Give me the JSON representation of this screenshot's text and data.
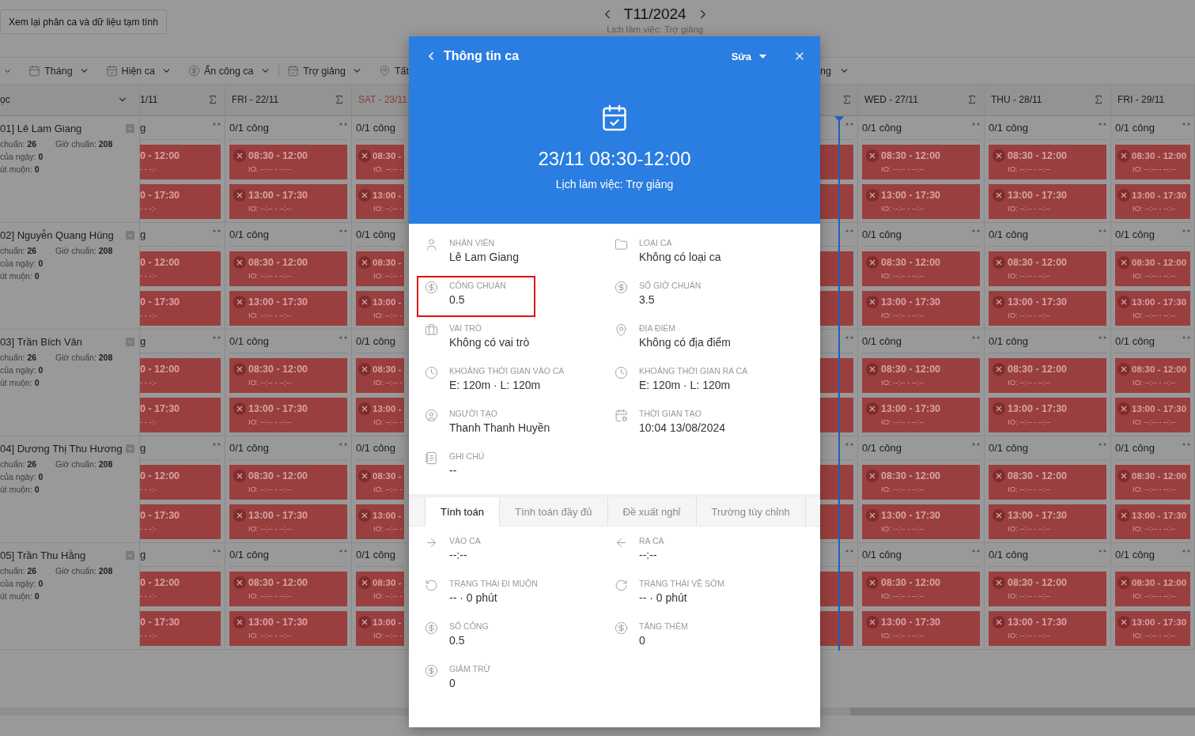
{
  "header": {
    "review_button": "Xem lại phân ca và dữ liệu tạm tính",
    "month": "T11/2024",
    "subtitle": "Lịch làm việc: Trợ giảng"
  },
  "toolbar": {
    "items": [
      {
        "label": "Tháng",
        "divider_before": false
      },
      {
        "label": "Hiện ca",
        "divider_before": false
      },
      {
        "label": "Ẩn công ca",
        "divider_before": false
      },
      {
        "label": "Trợ giảng",
        "divider_before": true
      },
      {
        "label": "Tất",
        "divider_before": false
      }
    ],
    "right_items": [
      {
        "label": "ng"
      }
    ]
  },
  "grid": {
    "employee_header": "ọc",
    "employees": [
      {
        "name": "01] Lê Lam Giang",
        "stats": [
          "chuẩn: **26**",
          "Giờ chuẩn: **208**",
          "của ngày: **0**",
          "út muộn: **0**"
        ]
      },
      {
        "name": "02] Nguyễn Quang Hùng",
        "stats": [
          "chuẩn: **26**",
          "Giờ chuẩn: **208**",
          "của ngày: **0**",
          "út muộn: **0**"
        ]
      },
      {
        "name": "03] Trần Bích Vân",
        "stats": [
          "chuẩn: **26**",
          "Giờ chuẩn: **208**",
          "của ngày: **0**",
          "út muộn: **0**"
        ]
      },
      {
        "name": "04] Dương Thị Thu Hương",
        "stats": [
          "chuẩn: **26**",
          "Giờ chuẩn: **208**",
          "của ngày: **0**",
          "út muộn: **0**"
        ]
      },
      {
        "name": "05] Trần Thu Hằng",
        "stats": [
          "chuẩn: **26**",
          "Giờ chuẩn: **208**",
          "của ngày: **0**",
          "út muộn: **0**"
        ]
      }
    ],
    "left_columns": [
      {
        "kind": "cut_left",
        "header": "1/11",
        "weekend": false,
        "cells": [
          {
            "count": "g",
            "shifts": [
              {
                "cancelled": true,
                "time": "0 - 12:00",
                "io": "- - -:-"
              },
              {
                "cancelled": true,
                "time": "0 - 17:30",
                "io": "- - -:-"
              }
            ]
          },
          {
            "count": "g",
            "shifts": [
              {
                "cancelled": true,
                "time": "0 - 12:00",
                "io": "- - -:-"
              },
              {
                "cancelled": true,
                "time": "0 - 17:30",
                "io": "- - -:-"
              }
            ]
          },
          {
            "count": "g",
            "shifts": [
              {
                "cancelled": true,
                "time": "0 - 12:00",
                "io": "- - -:-"
              },
              {
                "cancelled": true,
                "time": "0 - 17:30",
                "io": "- - -:-"
              }
            ]
          },
          {
            "count": "g",
            "shifts": [
              {
                "cancelled": true,
                "time": "0 - 12:00",
                "io": "- - -:-"
              },
              {
                "cancelled": true,
                "time": "0 - 17:30",
                "io": "- - -:-"
              }
            ]
          },
          {
            "count": "g",
            "shifts": [
              {
                "cancelled": true,
                "time": "0 - 12:00",
                "io": "- - -:-"
              },
              {
                "cancelled": true,
                "time": "0 - 17:30",
                "io": "- - -:-"
              }
            ]
          }
        ]
      },
      {
        "kind": "full",
        "header": "FRI - 22/11",
        "weekend": false,
        "cells": [
          {
            "count": "0/1 công",
            "shifts": [
              {
                "cancelled": true,
                "time": "08:30 - 12:00",
                "io": "IO: --:-- - --:--"
              },
              {
                "cancelled": true,
                "time": "13:00 - 17:30",
                "io": "IO: --:-- - --:--"
              }
            ]
          },
          {
            "count": "0/1 công",
            "shifts": [
              {
                "cancelled": true,
                "time": "08:30 - 12:00",
                "io": "IO: --:-- - --:--"
              },
              {
                "cancelled": true,
                "time": "13:00 - 17:30",
                "io": "IO: --:-- - --:--"
              }
            ]
          },
          {
            "count": "0/1 công",
            "shifts": [
              {
                "cancelled": true,
                "time": "08:30 - 12:00",
                "io": "IO: --:-- - --:--"
              },
              {
                "cancelled": true,
                "time": "13:00 - 17:30",
                "io": "IO: --:-- - --:--"
              }
            ]
          },
          {
            "count": "0/1 công",
            "shifts": [
              {
                "cancelled": true,
                "time": "08:30 - 12:00",
                "io": "IO: --:-- - --:--"
              },
              {
                "cancelled": true,
                "time": "13:00 - 17:30",
                "io": "IO: --:-- - --:--"
              }
            ]
          },
          {
            "count": "0/1 công",
            "shifts": [
              {
                "cancelled": true,
                "time": "08:30 - 12:00",
                "io": "IO: --:-- - --:--"
              },
              {
                "cancelled": true,
                "time": "13:00 - 17:30",
                "io": "IO: --:-- - --:--"
              }
            ]
          }
        ]
      },
      {
        "kind": "cut_right",
        "header": "SAT - 23/11",
        "weekend": true,
        "cells": [
          {
            "count": "0/1 công",
            "shifts": [
              {
                "cancelled": true,
                "time": "08:30 -",
                "io": "IO: --:-- -"
              },
              {
                "cancelled": true,
                "time": "13:00 -",
                "io": "IO: --:-- -"
              }
            ]
          },
          {
            "count": "0/1 công",
            "shifts": [
              {
                "cancelled": true,
                "time": "08:30 -",
                "io": "IO: --:-- -"
              },
              {
                "cancelled": true,
                "time": "13:00 -",
                "io": "IO: --:-- -"
              }
            ]
          },
          {
            "count": "0/1 công",
            "shifts": [
              {
                "cancelled": true,
                "time": "08:30 -",
                "io": "IO: --:-- -"
              },
              {
                "cancelled": true,
                "time": "13:00 -",
                "io": "IO: --:-- -"
              }
            ]
          },
          {
            "count": "0/1 công",
            "shifts": [
              {
                "cancelled": true,
                "time": "08:30 -",
                "io": "IO: --:-- -"
              },
              {
                "cancelled": true,
                "time": "13:00 -",
                "io": "IO: --:-- -"
              }
            ]
          },
          {
            "count": "0/1 công",
            "shifts": [
              {
                "cancelled": true,
                "time": "08:30 -",
                "io": "IO: --:-- -"
              },
              {
                "cancelled": true,
                "time": "13:00 -",
                "io": "IO: --:-- -"
              }
            ]
          }
        ]
      }
    ],
    "right_columns": [
      {
        "kind": "edge",
        "weekend": false,
        "today": true,
        "cells": [
          {
            "shifts": [
              {
                "cancelled": true
              },
              {
                "cancelled": true
              }
            ]
          },
          {
            "shifts": [
              {
                "cancelled": true
              },
              {
                "cancelled": true
              }
            ]
          },
          {
            "shifts": [
              {
                "cancelled": true
              },
              {
                "cancelled": true
              }
            ]
          },
          {
            "shifts": [
              {
                "cancelled": true
              },
              {
                "cancelled": true
              }
            ]
          },
          {
            "shifts": [
              {
                "cancelled": true
              },
              {
                "cancelled": true
              }
            ]
          }
        ]
      },
      {
        "kind": "full",
        "header": "WED - 27/11",
        "weekend": false,
        "today": false,
        "cells": [
          {
            "count": "0/1 công",
            "shifts": [
              {
                "cancelled": true,
                "time": "08:30 - 12:00",
                "io": "IO: --:-- - --:--"
              },
              {
                "cancelled": true,
                "time": "13:00 - 17:30",
                "io": "IO: --:-- - --:--"
              }
            ]
          },
          {
            "count": "0/1 công",
            "shifts": [
              {
                "cancelled": true,
                "time": "08:30 - 12:00",
                "io": "IO: --:-- - --:--"
              },
              {
                "cancelled": true,
                "time": "13:00 - 17:30",
                "io": "IO: --:-- - --:--"
              }
            ]
          },
          {
            "count": "0/1 công",
            "shifts": [
              {
                "cancelled": true,
                "time": "08:30 - 12:00",
                "io": "IO: --:-- - --:--"
              },
              {
                "cancelled": true,
                "time": "13:00 - 17:30",
                "io": "IO: --:-- - --:--"
              }
            ]
          },
          {
            "count": "0/1 công",
            "shifts": [
              {
                "cancelled": true,
                "time": "08:30 - 12:00",
                "io": "IO: --:-- - --:--"
              },
              {
                "cancelled": true,
                "time": "13:00 - 17:30",
                "io": "IO: --:-- - --:--"
              }
            ]
          },
          {
            "count": "0/1 công",
            "shifts": [
              {
                "cancelled": true,
                "time": "08:30 - 12:00",
                "io": "IO: --:-- - --:--"
              },
              {
                "cancelled": true,
                "time": "13:00 - 17:30",
                "io": "IO: --:-- - --:--"
              }
            ]
          }
        ]
      },
      {
        "kind": "full",
        "header": "THU - 28/11",
        "weekend": false,
        "today": false,
        "cells": [
          {
            "count": "0/1 công",
            "shifts": [
              {
                "cancelled": true,
                "time": "08:30 - 12:00",
                "io": "IO: --:-- - --:--"
              },
              {
                "cancelled": true,
                "time": "13:00 - 17:30",
                "io": "IO: --:-- - --:--"
              }
            ]
          },
          {
            "count": "0/1 công",
            "shifts": [
              {
                "cancelled": true,
                "time": "08:30 - 12:00",
                "io": "IO: --:-- - --:--"
              },
              {
                "cancelled": true,
                "time": "13:00 - 17:30",
                "io": "IO: --:-- - --:--"
              }
            ]
          },
          {
            "count": "0/1 công",
            "shifts": [
              {
                "cancelled": true,
                "time": "08:30 - 12:00",
                "io": "IO: --:-- - --:--"
              },
              {
                "cancelled": true,
                "time": "13:00 - 17:30",
                "io": "IO: --:-- - --:--"
              }
            ]
          },
          {
            "count": "0/1 công",
            "shifts": [
              {
                "cancelled": true,
                "time": "08:30 - 12:00",
                "io": "IO: --:-- - --:--"
              },
              {
                "cancelled": true,
                "time": "13:00 - 17:30",
                "io": "IO: --:-- - --:--"
              }
            ]
          },
          {
            "count": "0/1 công",
            "shifts": [
              {
                "cancelled": true,
                "time": "08:30 - 12:00",
                "io": "IO: --:-- - --:--"
              },
              {
                "cancelled": true,
                "time": "13:00 - 17:30",
                "io": "IO: --:-- - --:--"
              }
            ]
          }
        ]
      },
      {
        "kind": "last",
        "header": "FRI - 29/11",
        "weekend": false,
        "today": false,
        "cells": [
          {
            "count": "0/1 công",
            "shifts": [
              {
                "cancelled": true,
                "time": "08:30 - 12:00",
                "io": "IO: --:-- - --:--"
              },
              {
                "cancelled": true,
                "time": "13:00 - 17:30",
                "io": "IO: --:-- - --:--"
              }
            ]
          },
          {
            "count": "0/1 công",
            "shifts": [
              {
                "cancelled": true,
                "time": "08:30 - 12:00",
                "io": "IO: --:-- - --:--"
              },
              {
                "cancelled": true,
                "time": "13:00 - 17:30",
                "io": "IO: --:-- - --:--"
              }
            ]
          },
          {
            "count": "0/1 công",
            "shifts": [
              {
                "cancelled": true,
                "time": "08:30 - 12:00",
                "io": "IO: --:-- - --:--"
              },
              {
                "cancelled": true,
                "time": "13:00 - 17:30",
                "io": "IO: --:-- - --:--"
              }
            ]
          },
          {
            "count": "0/1 công",
            "shifts": [
              {
                "cancelled": true,
                "time": "08:30 - 12:00",
                "io": "IO: --:-- - --:--"
              },
              {
                "cancelled": true,
                "time": "13:00 - 17:30",
                "io": "IO: --:-- - --:--"
              }
            ]
          },
          {
            "count": "0/1 công",
            "shifts": [
              {
                "cancelled": true,
                "time": "08:30 - 12:00",
                "io": "IO: --:-- - --:--"
              },
              {
                "cancelled": true,
                "time": "13:00 - 17:30",
                "io": "IO: --:-- - --:--"
              }
            ]
          }
        ]
      }
    ]
  },
  "modal": {
    "title": "Thông tin ca",
    "edit": "Sửa",
    "date_time": "23/11 08:30-12:00",
    "schedule": "Lịch làm việc: Trợ giảng",
    "fields": [
      {
        "label": "NHÂN VIÊN",
        "value": "Lê Lam Giang",
        "highlighted": false
      },
      {
        "label": "LOẠI CA",
        "value": "Không có loại ca",
        "highlighted": false
      },
      {
        "label": "CÔNG CHUẨN",
        "value": "0.5",
        "highlighted": true
      },
      {
        "label": "SỐ GIỜ CHUẨN",
        "value": "3.5",
        "highlighted": false
      },
      {
        "label": "VAI TRÒ",
        "value": "Không có vai trò",
        "highlighted": false
      },
      {
        "label": "ĐỊA ĐIỂM",
        "value": "Không có địa điểm",
        "highlighted": false
      },
      {
        "label": "KHOẢNG THỜI GIAN VÀO CA",
        "value": "E: 120m · L: 120m",
        "highlighted": false
      },
      {
        "label": "KHOẢNG THỜI GIAN RA CA",
        "value": "E: 120m · L: 120m",
        "highlighted": false
      },
      {
        "label": "NGƯỜI TẠO",
        "value": "Thanh Thanh Huyền",
        "highlighted": false
      },
      {
        "label": "THỜI GIAN TẠO",
        "value": "10:04 13/08/2024",
        "highlighted": false
      },
      {
        "label": "GHI CHÚ",
        "value": "--",
        "highlighted": false
      }
    ],
    "tabs": [
      {
        "label": "Tính toán",
        "selected": true
      },
      {
        "label": "Tính toán đầy đủ",
        "selected": false
      },
      {
        "label": "Đề xuất nghỉ",
        "selected": false
      },
      {
        "label": "Trường tùy chỉnh",
        "selected": false
      }
    ],
    "calc_fields": [
      {
        "label": "VÀO CA",
        "value": "--:--"
      },
      {
        "label": "RA CA",
        "value": "--:--"
      },
      {
        "label": "TRẠNG THÁI ĐI MUỘN",
        "value": "-- · 0 phút"
      },
      {
        "label": "TRẠNG THÁI VỀ SỚM",
        "value": "-- · 0 phút"
      },
      {
        "label": "SỐ CÔNG",
        "value": "0.5"
      },
      {
        "label": "TĂNG THÊM",
        "value": "0"
      },
      {
        "label": "GIẢM TRỪ",
        "value": "0"
      }
    ]
  }
}
